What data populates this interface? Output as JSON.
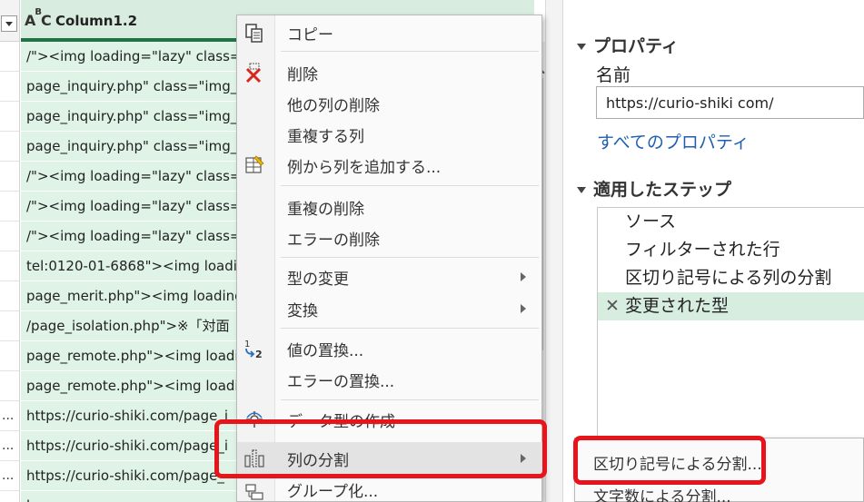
{
  "grid": {
    "column_title": "Column1.2",
    "type_badge": "ABC",
    "rows": [
      {
        "left": "",
        "main": "/\"><img loading=\"lazy\" class=\""
      },
      {
        "left": "",
        "main": "page_inquiry.php\" class=\"img_"
      },
      {
        "left": "",
        "main": "page_inquiry.php\" class=\"img_"
      },
      {
        "left": "",
        "main": "page_inquiry.php\" class=\"img_"
      },
      {
        "left": "",
        "main": "/\"><img loading=\"lazy\" class=\""
      },
      {
        "left": "",
        "main": "/\"><img loading=\"lazy\" class=\""
      },
      {
        "left": "",
        "main": "/\"><img loading=\"lazy\" class=\""
      },
      {
        "left": "",
        "main": "tel:0120-01-6868\"><img loadin"
      },
      {
        "left": "",
        "main": "page_merit.php\"><img loading"
      },
      {
        "left": "",
        "main": "/page_isolation.php\">※「対面"
      },
      {
        "left": "",
        "main": "page_remote.php\"><img loadi"
      },
      {
        "left": "",
        "main": "page_remote.php\"><img loadi"
      },
      {
        "left": "...",
        "main": "https://curio-shiki.com/page_i"
      },
      {
        "left": "...",
        "main": "https://curio-shiki.com/page_i"
      },
      {
        "left": "...",
        "main": "https://curio-shiki.com/page_"
      },
      {
        "left": "",
        "main": "h..."
      }
    ]
  },
  "context_menu": {
    "items": [
      {
        "label": "コピー",
        "icon": "copy-icon"
      },
      {
        "label": "削除",
        "icon": "delete-column-icon"
      },
      {
        "label": "他の列の削除",
        "icon": ""
      },
      {
        "label": "重複する列",
        "icon": ""
      },
      {
        "label": "例から列を追加する...",
        "icon": "column-from-examples-icon"
      },
      {
        "label": "重複の削除",
        "icon": ""
      },
      {
        "label": "エラーの削除",
        "icon": ""
      },
      {
        "label": "型の変更",
        "icon": ""
      },
      {
        "label": "変換",
        "icon": ""
      },
      {
        "label": "値の置換...",
        "icon": "replace-values-icon"
      },
      {
        "label": "エラーの置換...",
        "icon": ""
      },
      {
        "label": "データ型の作成",
        "icon": "create-data-type-icon"
      },
      {
        "label": "列の分割",
        "icon": "split-column-icon"
      },
      {
        "label": "グループ化...",
        "icon": "group-by-icon"
      }
    ],
    "replace_icon_text": {
      "top": "1",
      "bottom": "2"
    }
  },
  "submenu": {
    "items": [
      {
        "label": "区切り記号による分割..."
      },
      {
        "label": "文字数による分割..."
      }
    ]
  },
  "properties": {
    "section_title": "プロパティ",
    "name_label": "名前",
    "name_value": "https://curio-shiki com/",
    "all_properties_link": "すべてのプロパティ"
  },
  "applied_steps": {
    "section_title": "適用したステップ",
    "steps": [
      {
        "label": "ソース"
      },
      {
        "label": "フィルターされた行"
      },
      {
        "label": "区切り記号による列の分割"
      },
      {
        "label": "変更された型"
      }
    ],
    "selected_index": 3,
    "delete_icon_glyph": "✕"
  },
  "colors": {
    "accent_green": "#217346",
    "column_selected_bg": "#dff3e7",
    "step_selected_bg": "#d7ede0",
    "highlight_red": "#e8141b",
    "link_blue": "#1f5fb0"
  }
}
